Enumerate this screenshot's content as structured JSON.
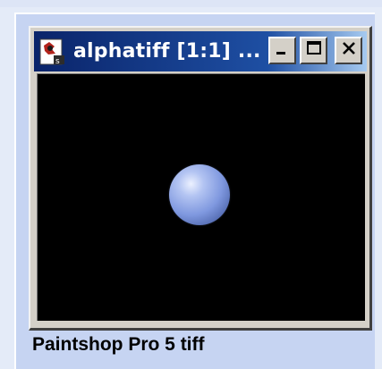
{
  "window": {
    "title": "alphatiff [1:1] ...",
    "icon": "app-document-icon",
    "controls": {
      "minimize": "minimize-icon",
      "maximize": "maximize-icon",
      "close": "close-icon"
    }
  },
  "caption": "Paintshop Pro 5 tiff",
  "colors": {
    "title_bar_start": "#0a246a",
    "title_bar_end": "#a6caf0",
    "page_background": "#c6d4f2",
    "viewport_background": "#000000",
    "sphere": "#7f98df"
  }
}
